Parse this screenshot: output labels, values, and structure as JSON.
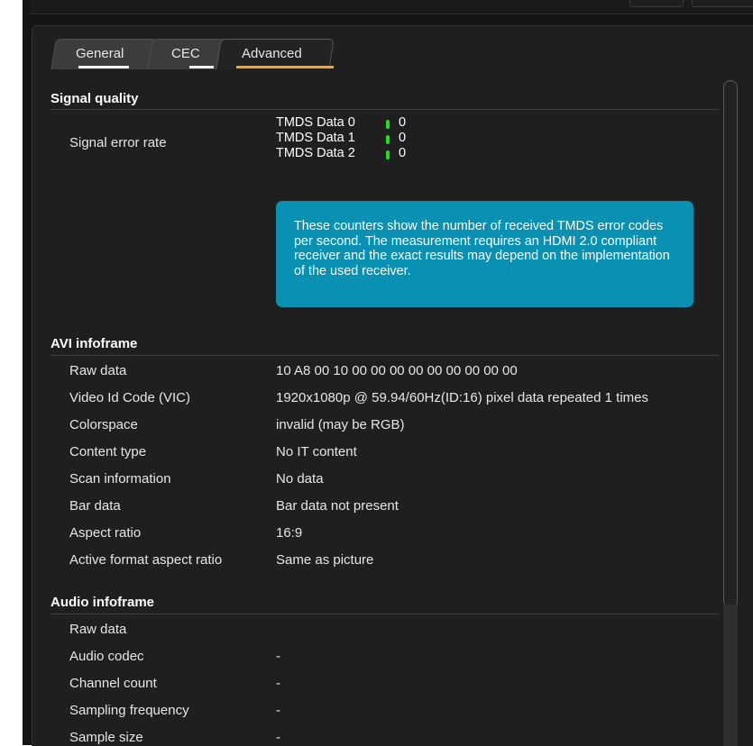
{
  "tabs": [
    {
      "label": "General",
      "active": false,
      "underline": "#f0f0f0"
    },
    {
      "label": "CEC",
      "active": false,
      "underline": "#f0f0f0"
    },
    {
      "label": "Advanced",
      "active": true,
      "underline": "#f5a623"
    }
  ],
  "signal_quality": {
    "title": "Signal quality",
    "error_rate_label": "Signal error rate",
    "tmds": [
      {
        "name": "TMDS Data 0",
        "value": "0"
      },
      {
        "name": "TMDS Data 1",
        "value": "0"
      },
      {
        "name": "TMDS Data 2",
        "value": "0"
      }
    ],
    "indicator_color": "#1ee01e",
    "info_box_color": "#0891b2",
    "info_text": "These counters show the number of received TMDS error codes per second. The measurement requires an HDMI 2.0 compliant receiver and the exact results may depend on the implementation of the used receiver."
  },
  "avi_infoframe": {
    "title": "AVI infoframe",
    "rows": [
      {
        "label": "Raw data",
        "value": "10 A8 00 10 00 00 00 00 00 00 00 00 00"
      },
      {
        "label": "Video Id Code (VIC)",
        "value": "1920x1080p @ 59.94/60Hz(ID:16) pixel data repeated 1 times"
      },
      {
        "label": "Colorspace",
        "value": "invalid (may be RGB)"
      },
      {
        "label": "Content type",
        "value": "No IT content"
      },
      {
        "label": "Scan information",
        "value": "No data"
      },
      {
        "label": "Bar data",
        "value": "Bar data not present"
      },
      {
        "label": "Aspect ratio",
        "value": "16:9"
      },
      {
        "label": "Active format aspect ratio",
        "value": "Same as picture"
      }
    ]
  },
  "audio_infoframe": {
    "title": "Audio infoframe",
    "rows": [
      {
        "label": "Raw data",
        "value": ""
      },
      {
        "label": "Audio codec",
        "value": "-"
      },
      {
        "label": "Channel count",
        "value": "-"
      },
      {
        "label": "Sampling frequency",
        "value": "-"
      },
      {
        "label": "Sample size",
        "value": "-"
      }
    ]
  }
}
